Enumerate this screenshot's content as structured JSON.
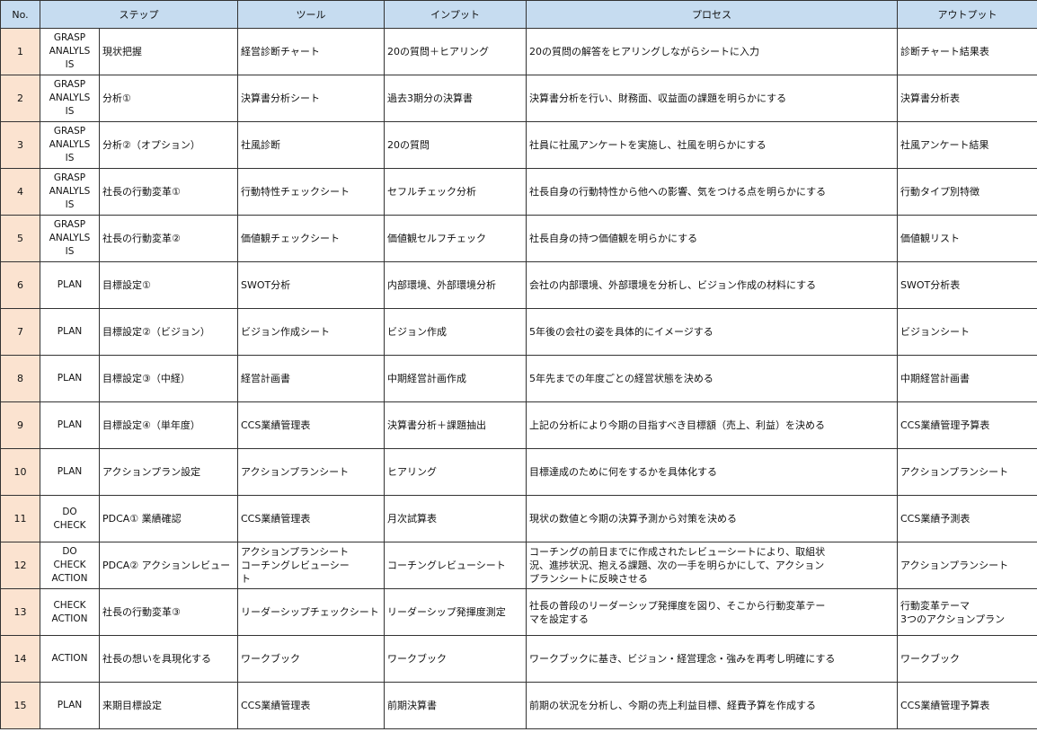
{
  "headers": {
    "no": "No.",
    "step": "ステップ",
    "tool": "ツール",
    "input": "インプット",
    "process": "プロセス",
    "output": "アウトプット"
  },
  "rows": [
    {
      "no": "1",
      "category": "GRASP\nANALYLS\nIS",
      "step": "現状把握",
      "tool": "経営診断チャート",
      "input": "20の質問＋ヒアリング",
      "process": "20の質問の解答をヒアリングしながらシートに入力",
      "output": "診断チャート結果表"
    },
    {
      "no": "2",
      "category": "GRASP\nANALYLS\nIS",
      "step": "分析①",
      "tool": "決算書分析シート",
      "input": "過去3期分の決算書",
      "process": "決算書分析を行い、財務面、収益面の課題を明らかにする",
      "output": "決算書分析表"
    },
    {
      "no": "3",
      "category": "GRASP\nANALYLS\nIS",
      "step": "分析②（オプション）",
      "tool": "社風診断",
      "input": "20の質問",
      "process": "社員に社風アンケートを実施し、社風を明らかにする",
      "output": "社風アンケート結果"
    },
    {
      "no": "4",
      "category": "GRASP\nANALYLS\nIS",
      "step": "社長の行動変革①",
      "tool": "行動特性チェックシート",
      "input": "セフルチェック分析",
      "process": "社長自身の行動特性から他への影響、気をつける点を明らかにする",
      "output": "行動タイプ別特徴"
    },
    {
      "no": "5",
      "category": "GRASP\nANALYLS\nIS",
      "step": "社長の行動変革②",
      "tool": "価値観チェックシート",
      "input": "価値観セルフチェック",
      "process": "社長自身の持つ価値観を明らかにする",
      "output": "価値観リスト"
    },
    {
      "no": "6",
      "category": "PLAN",
      "step": "目標設定①",
      "tool": "SWOT分析",
      "input": "内部環境、外部環境分析",
      "process": "会社の内部環境、外部環境を分析し、ビジョン作成の材料にする",
      "output": "SWOT分析表"
    },
    {
      "no": "7",
      "category": "PLAN",
      "step": "目標設定②（ビジョン）",
      "tool": "ビジョン作成シート",
      "input": "ビジョン作成",
      "process": "5年後の会社の姿を具体的にイメージする",
      "output": "ビジョンシート"
    },
    {
      "no": "8",
      "category": "PLAN",
      "step": "目標設定③（中経）",
      "tool": "経営計画書",
      "input": "中期経営計画作成",
      "process": "5年先までの年度ごとの経営状態を決める",
      "output": "中期経営計画書"
    },
    {
      "no": "9",
      "category": "PLAN",
      "step": "目標設定④（単年度）",
      "tool": "CCS業績管理表",
      "input": "決算書分析＋課題抽出",
      "process": "上記の分析により今期の目指すべき目標額（売上、利益）を決める",
      "output": "CCS業績管理予算表"
    },
    {
      "no": "10",
      "category": "PLAN",
      "step": "アクションプラン設定",
      "tool": "アクションプランシート",
      "input": "ヒアリング",
      "process": "目標達成のために何をするかを具体化する",
      "output": "アクションプランシート"
    },
    {
      "no": "11",
      "category": "DO\nCHECK",
      "step": "PDCA① 業績確認",
      "tool": "CCS業績管理表",
      "input": "月次試算表",
      "process": "現状の数値と今期の決算予測から対策を決める",
      "output": "CCS業績予測表"
    },
    {
      "no": "12",
      "category": "DO\nCHECK\nACTION",
      "step": "PDCA② アクションレビュー",
      "tool": "アクションプランシート\nコーチングレビューシー\nト",
      "input": "コーチングレビューシート",
      "process": "コーチングの前日までに作成されたレビューシートにより、取組状\n況、進捗状況、抱える課題、次の一手を明らかにして、アクション\nプランシートに反映させる",
      "output": "アクションプランシート"
    },
    {
      "no": "13",
      "category": "CHECK\nACTION",
      "step": "社長の行動変革③",
      "tool": "リーダーシップチェックシート",
      "input": "リーダーシップ発揮度測定",
      "process": "社長の普段のリーダーシップ発揮度を図り、そこから行動変革テー\nマを設定する",
      "output": "行動変革テーマ\n 3つのアクションプラン"
    },
    {
      "no": "14",
      "category": "ACTION",
      "step": "社長の想いを具現化する",
      "tool": "ワークブック",
      "input": "ワークブック",
      "process": "ワークブックに基き、ビジョン・経営理念・強みを再考し明確にする",
      "output": "ワークブック"
    },
    {
      "no": "15",
      "category": "PLAN",
      "step": "来期目標設定",
      "tool": "CCS業績管理表",
      "input": "前期決算書",
      "process": "前期の状況を分析し、今期の売上利益目標、経費予算を作成する",
      "output": "CCS業績管理予算表"
    }
  ]
}
